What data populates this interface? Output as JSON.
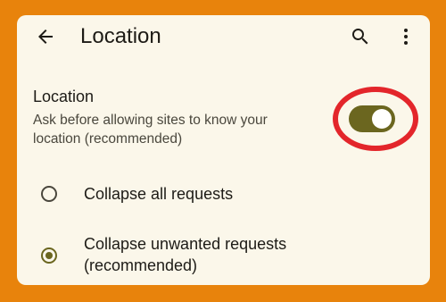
{
  "appbar": {
    "title": "Location",
    "back_icon": "arrow-back-icon",
    "search_icon": "search-icon",
    "more_icon": "more-vert-icon"
  },
  "location_setting": {
    "title": "Location",
    "description": "Ask before allowing sites to know your location (recommended)",
    "toggle_on": true
  },
  "options": [
    {
      "label": "Collapse all requests",
      "selected": false
    },
    {
      "label": "Collapse unwanted requests (recommended)",
      "selected": true
    }
  ],
  "colors": {
    "background": "#E8830C",
    "card": "#FBF7EA",
    "accent": "#6B661F",
    "annotation_ring": "#E3262B"
  }
}
